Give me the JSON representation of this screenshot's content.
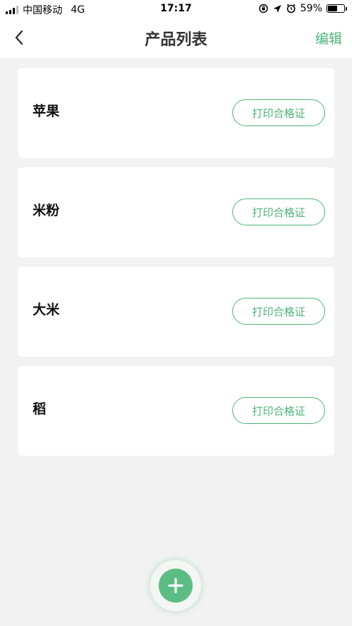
{
  "status_bar": {
    "carrier": "中国移动",
    "network": "4G",
    "time": "17:17",
    "battery_percent": "59%",
    "battery_level": 0.59
  },
  "nav": {
    "title": "产品列表",
    "edit_label": "编辑"
  },
  "products": [
    {
      "name": "苹果",
      "button_label": "打印合格证"
    },
    {
      "name": "米粉",
      "button_label": "打印合格证"
    },
    {
      "name": "大米",
      "button_label": "打印合格证"
    },
    {
      "name": "稻",
      "button_label": "打印合格证"
    }
  ],
  "colors": {
    "accent": "#4cb57a",
    "fab": "#5cbd84",
    "background": "#f2f2f2"
  },
  "icons": {
    "back": "chevron-left-icon",
    "fab": "plus-icon"
  }
}
